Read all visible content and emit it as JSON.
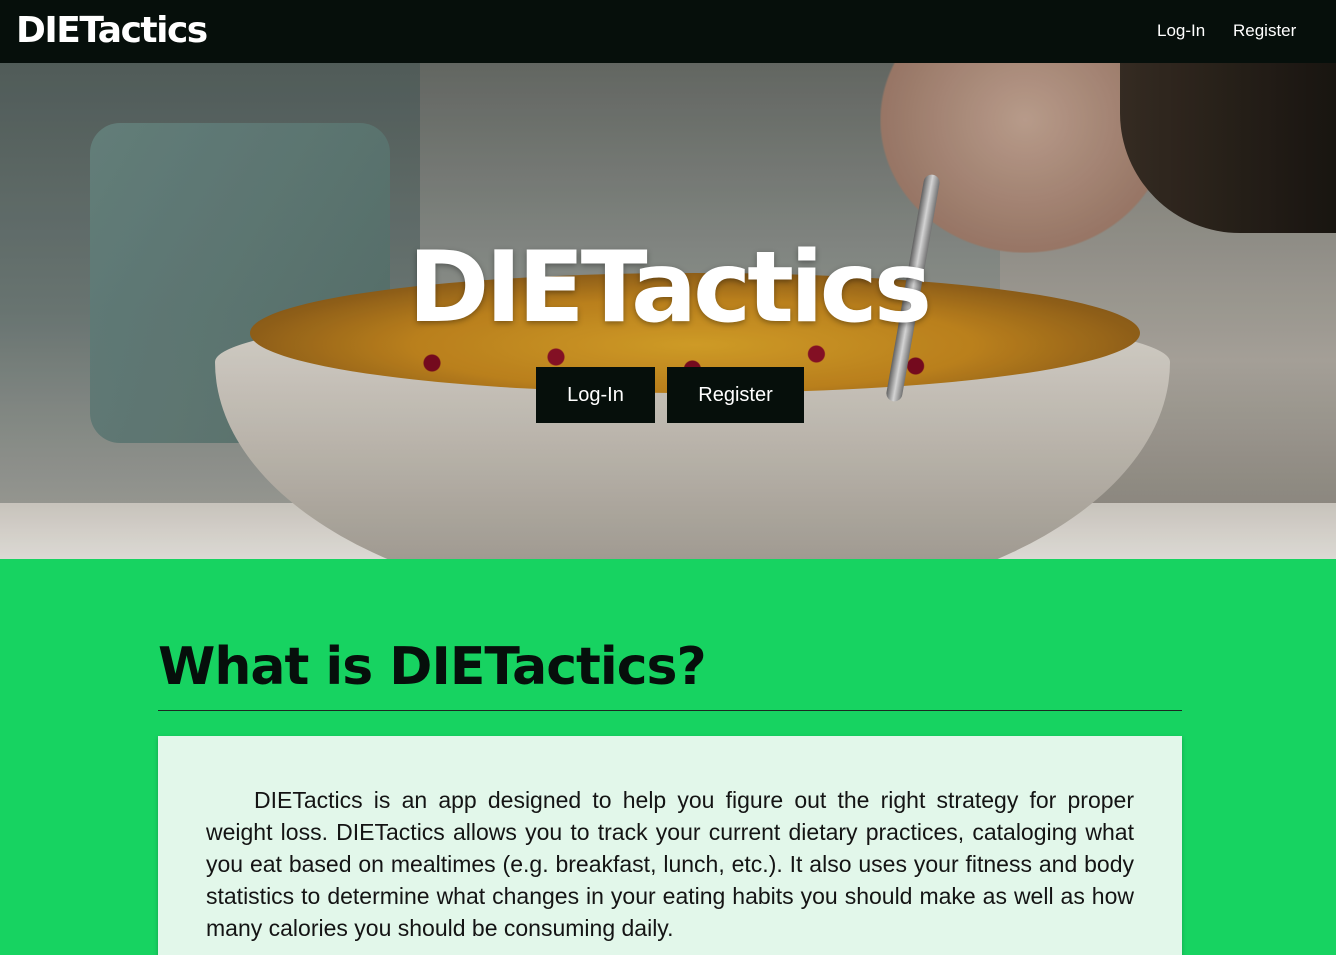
{
  "navbar": {
    "brand": "DIETactics",
    "login_label": "Log-In",
    "register_label": "Register"
  },
  "hero": {
    "title": "DIETactics",
    "login_label": "Log-In",
    "register_label": "Register"
  },
  "about": {
    "heading": "What is DIETactics?",
    "body": "DIETactics is an app designed to help you figure out the right strategy for proper weight loss. DIETactics allows you to track your current dietary practices, cataloging what you eat based on mealtimes (e.g. breakfast, lunch, etc.). It also uses your fitness and body statistics to determine what changes in your eating habits you should make as well as how many calories you should be consuming daily."
  },
  "colors": {
    "navbar_bg": "#060f0b",
    "accent_green": "#17d361",
    "card_bg": "#e2f7ea"
  }
}
